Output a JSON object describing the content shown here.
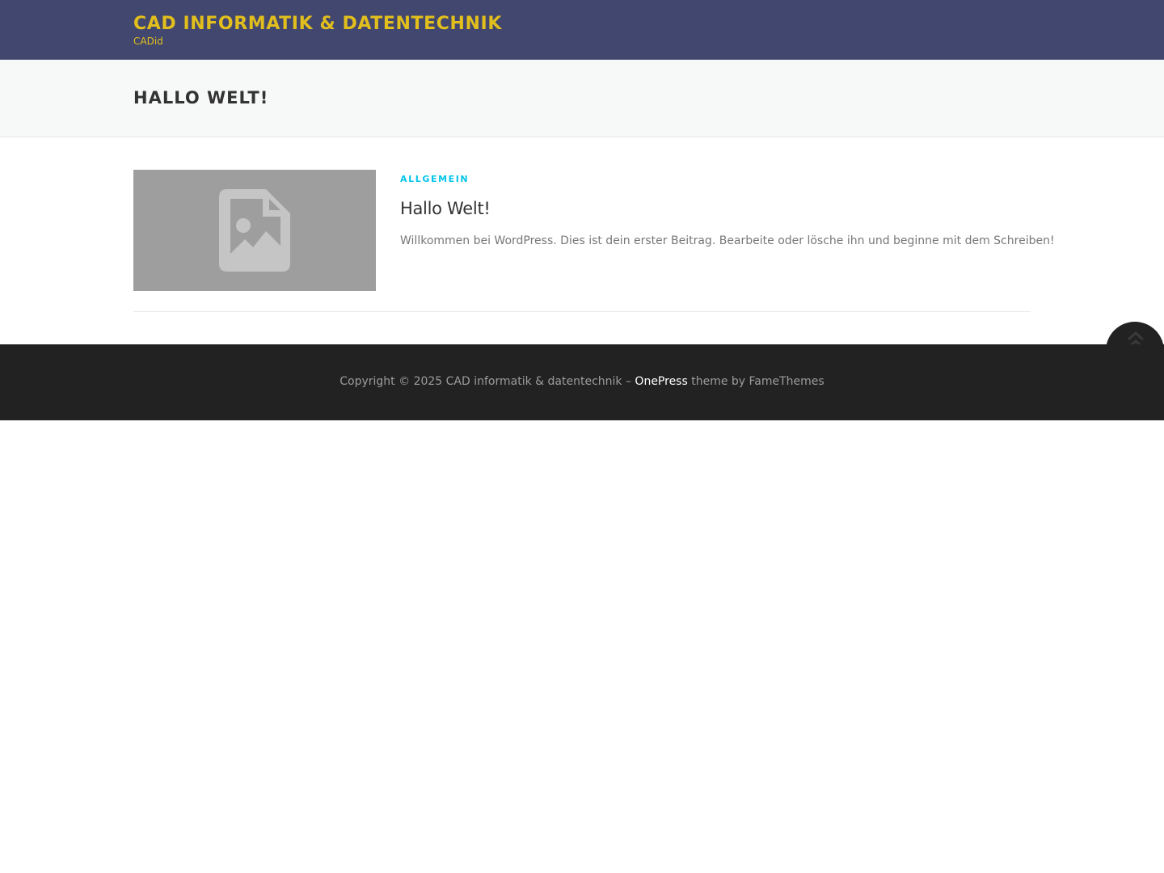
{
  "header": {
    "site_title": "CAD INFORMATIK & DATENTECHNIK",
    "tagline": "CADid"
  },
  "page": {
    "title": "HALLO WELT!"
  },
  "posts": [
    {
      "category": "ALLGEMEIN",
      "title": "Hallo Welt!",
      "excerpt": "Willkommen bei WordPress. Dies ist dein erster Beitrag. Bearbeite oder lösche ihn und beginne mit dem Schreiben!",
      "thumbnail_icon": "image-placeholder-icon"
    }
  ],
  "footer": {
    "copyright": "Copyright © 2025 CAD informatik & datentechnik –",
    "theme_link": "OnePress",
    "theme_by": "theme by FameThemes"
  },
  "back_to_top_icon": "double-chevron-up-icon",
  "colors": {
    "header_bg": "#41476e",
    "brand": "#e2bf1d",
    "accent": "#03c4eb",
    "footer_bg": "#222222"
  }
}
